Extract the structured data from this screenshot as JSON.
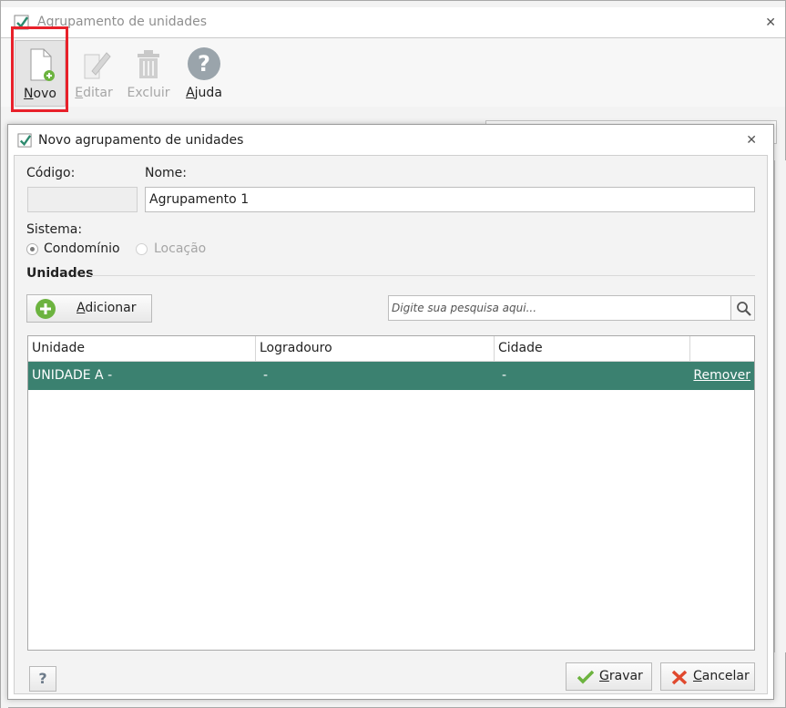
{
  "background_window": {
    "title": "Agrupamento de unidades",
    "toolbar": {
      "novo_label": "Novo",
      "editar_label": "Editar",
      "excluir_label": "Excluir",
      "ajuda_label": "Ajuda"
    }
  },
  "dialog": {
    "title": "Novo agrupamento de unidades",
    "codigo_label": "Código:",
    "codigo_value": "",
    "nome_label": "Nome:",
    "nome_value": "Agrupamento 1",
    "sistema_label": "Sistema:",
    "sistema_options": [
      {
        "label": "Condomínio",
        "selected": true,
        "enabled": true
      },
      {
        "label": "Locação",
        "selected": false,
        "enabled": false
      }
    ],
    "unidades_section": "Unidades",
    "adicionar_label": "Adicionar",
    "search_placeholder": "Digite sua pesquisa aqui...",
    "table": {
      "columns": [
        "Unidade",
        "Logradouro",
        "Cidade",
        ""
      ],
      "rows": [
        {
          "unidade": "UNIDADE A -",
          "logradouro": "-",
          "cidade": "-",
          "action": "Remover"
        }
      ]
    },
    "help_label": "?",
    "gravar_label": "Gravar",
    "cancelar_label": "Cancelar"
  },
  "colors": {
    "selected_row": "#3b8170",
    "highlight_box": "#e8212a",
    "add_icon": "#6cb33f",
    "check_icon": "#2d8a6e"
  },
  "icons": [
    "check-icon",
    "new-document-icon",
    "edit-pencil-icon",
    "trash-icon",
    "help-circle-icon",
    "plus-circle-icon",
    "search-icon",
    "checkmark-icon",
    "x-icon",
    "close-icon"
  ]
}
